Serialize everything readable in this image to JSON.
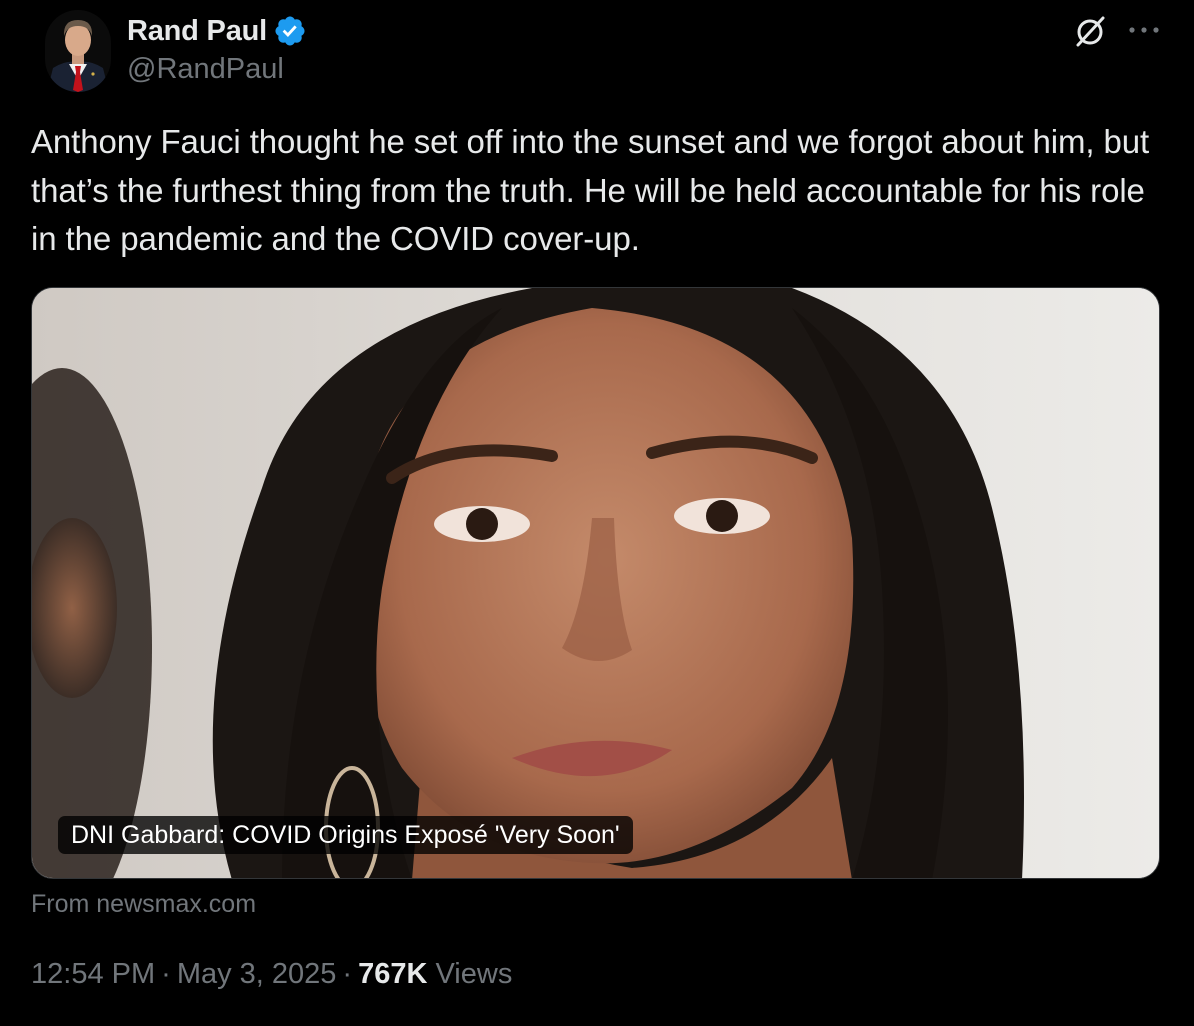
{
  "author": {
    "display_name": "Rand Paul",
    "handle": "@RandPaul",
    "verified": true,
    "verified_color": "#1d9bf0"
  },
  "actions": {
    "grok_icon": "grok-icon",
    "more_icon": "more-horizontal-icon"
  },
  "tweet": {
    "text": "Anthony Fauci thought he set off into the sunset and we forgot about him, but that’s the furthest thing from the truth. He will be held accountable for his role in the pandemic and the COVID cover-up."
  },
  "link_card": {
    "title": "DNI Gabbard: COVID Origins Exposé 'Very Soon'",
    "source": "From newsmax.com",
    "image": "photo of a woman with long dark hair"
  },
  "meta": {
    "time": "12:54 PM",
    "separator": "·",
    "date": "May 3, 2025",
    "views_count": "767K",
    "views_label": "Views"
  }
}
